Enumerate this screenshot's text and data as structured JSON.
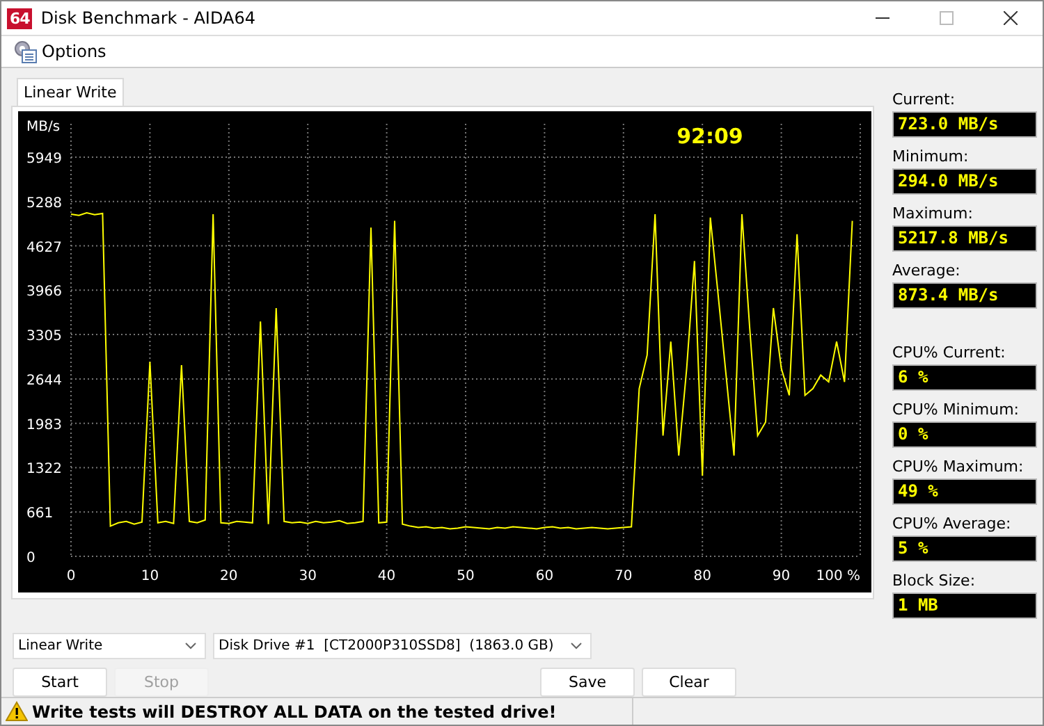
{
  "window": {
    "title": "Disk Benchmark - AIDA64",
    "app_icon": "64"
  },
  "menu": [
    {
      "label": "Options"
    }
  ],
  "tabs": [
    {
      "label": "Linear Write",
      "selected": true
    }
  ],
  "chart": {
    "timer": "92:09",
    "chart_data": {
      "type": "line",
      "grid": true,
      "ylabel": "MB/s",
      "xlim": [
        0,
        100
      ],
      "ylim": [
        0,
        5949
      ],
      "xticks": [
        0,
        10,
        20,
        30,
        40,
        50,
        60,
        70,
        80,
        90,
        {
          "value": 100,
          "label": "100 %"
        }
      ],
      "yticks": [
        0,
        661,
        1322,
        1983,
        2644,
        3305,
        3966,
        4627,
        5288,
        5949
      ],
      "x": [
        0,
        1,
        2,
        3,
        4,
        5,
        6,
        7,
        8,
        9,
        10,
        11,
        12,
        13,
        14,
        15,
        16,
        17,
        18,
        19,
        20,
        21,
        22,
        23,
        24,
        25,
        26,
        27,
        28,
        29,
        30,
        31,
        32,
        33,
        34,
        35,
        36,
        37,
        38,
        39,
        40,
        41,
        42,
        43,
        44,
        45,
        46,
        47,
        48,
        49,
        50,
        51,
        52,
        53,
        54,
        55,
        56,
        57,
        58,
        59,
        60,
        61,
        62,
        63,
        64,
        65,
        66,
        67,
        68,
        69,
        70,
        71,
        72,
        73,
        74,
        75,
        76,
        77,
        78,
        79,
        80,
        81,
        82,
        83,
        84,
        85,
        86,
        87,
        88,
        89,
        90,
        91,
        92,
        93,
        94,
        95,
        96,
        97,
        98,
        99
      ],
      "series": [
        {
          "color": "#ffff00",
          "values": [
            5100,
            5080,
            5120,
            5090,
            5110,
            450,
            500,
            520,
            480,
            510,
            2900,
            500,
            520,
            490,
            2850,
            520,
            500,
            540,
            5100,
            500,
            490,
            520,
            510,
            500,
            3500,
            480,
            3700,
            520,
            500,
            510,
            490,
            520,
            500,
            510,
            530,
            490,
            500,
            520,
            4900,
            500,
            510,
            5000,
            480,
            450,
            430,
            440,
            420,
            430,
            410,
            420,
            440,
            430,
            420,
            410,
            430,
            420,
            440,
            430,
            420,
            410,
            430,
            440,
            420,
            430,
            410,
            420,
            430,
            420,
            410,
            420,
            430,
            440,
            2500,
            3000,
            5100,
            1800,
            3200,
            1500,
            2800,
            4400,
            1200,
            5050,
            3900,
            2700,
            1500,
            5100,
            3400,
            1800,
            2000,
            3700,
            2800,
            2400,
            4800,
            2400,
            2500,
            2700,
            2600,
            3200,
            2600,
            5000
          ]
        }
      ]
    }
  },
  "stat_groups": [
    {
      "items": [
        {
          "label": "Current:",
          "value": "723.0 MB/s"
        },
        {
          "label": "Minimum:",
          "value": "294.0 MB/s"
        },
        {
          "label": "Maximum:",
          "value": "5217.8 MB/s"
        },
        {
          "label": "Average:",
          "value": "873.4 MB/s"
        }
      ]
    },
    {
      "items": [
        {
          "label": "CPU% Current:",
          "value": "6 %"
        },
        {
          "label": "CPU% Minimum:",
          "value": "0 %"
        },
        {
          "label": "CPU% Maximum:",
          "value": "49 %"
        },
        {
          "label": "CPU% Average:",
          "value": "5 %"
        },
        {
          "label": "Block Size:",
          "value": "1 MB"
        }
      ]
    }
  ],
  "test_select": {
    "value": "Linear Write"
  },
  "drive_select": {
    "value": "Disk Drive #1  [CT2000P310SSD8]  (1863.0 GB)"
  },
  "run_buttons": [
    {
      "label": "Start",
      "disabled": false
    },
    {
      "label": "Stop",
      "disabled": true
    }
  ],
  "file_buttons": [
    {
      "label": "Save",
      "disabled": false
    },
    {
      "label": "Clear",
      "disabled": false
    }
  ],
  "status_bar": {
    "warning": "Write tests will DESTROY ALL DATA on the tested drive!"
  }
}
